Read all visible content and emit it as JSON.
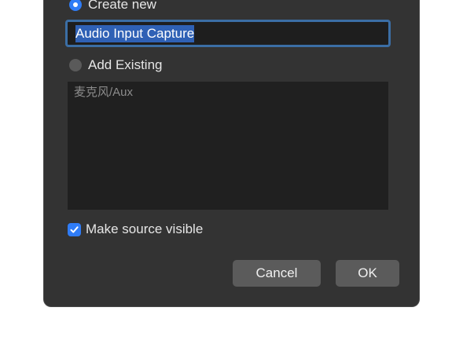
{
  "dialog": {
    "create_new": {
      "label": "Create new",
      "selected": true,
      "name_value": "Audio Input Capture"
    },
    "add_existing": {
      "label": "Add Existing",
      "selected": false,
      "items": [
        "麦克风/Aux"
      ]
    },
    "make_visible": {
      "label": "Make source visible",
      "checked": true
    },
    "buttons": {
      "cancel": "Cancel",
      "ok": "OK"
    }
  },
  "colors": {
    "accent": "#2f7cf6",
    "dialog_bg": "#333333",
    "field_bg": "#202020"
  }
}
